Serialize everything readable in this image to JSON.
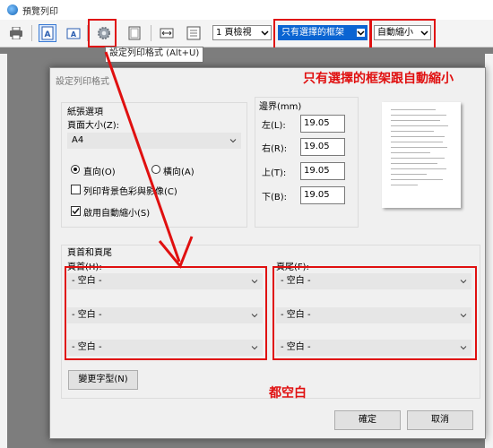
{
  "window": {
    "title": "預覽列印"
  },
  "toolbar": {
    "page_view": "1 頁檢視",
    "frames": "只有選擇的框架",
    "shrink": "自動縮小",
    "tooltip": "設定列印格式 (Alt+U)"
  },
  "dialog": {
    "title": "設定列印格式",
    "paper": {
      "heading": "紙張選項",
      "size_label": "頁面大小(Z):",
      "size_value": "A4",
      "portrait": "直向(O)",
      "landscape": "橫向(A)",
      "print_bg": "列印背景色彩與影像(C)",
      "shrink_to_fit": "啟用自動縮小(S)",
      "orientation_selected": "portrait",
      "print_bg_checked": false,
      "shrink_checked": true
    },
    "margins": {
      "heading": "邊界(mm)",
      "left_label": "左(L):",
      "left": "19.05",
      "right_label": "右(R):",
      "right": "19.05",
      "top_label": "上(T):",
      "top": "19.05",
      "bottom_label": "下(B):",
      "bottom": "19.05"
    },
    "header_footer": {
      "heading": "頁首和頁尾",
      "header_label": "頁首(H):",
      "footer_label": "頁尾(F):",
      "header": [
        "- 空白 -",
        "- 空白 -",
        "- 空白 -"
      ],
      "footer": [
        "- 空白 -",
        "- 空白 -",
        "- 空白 -"
      ]
    },
    "change_font": "變更字型(N)",
    "ok": "確定",
    "cancel": "取消"
  },
  "annotations": {
    "top_note": "只有選擇的框架跟自動縮小",
    "blank_note": "都空白",
    "highlight_color": "#e01010"
  }
}
